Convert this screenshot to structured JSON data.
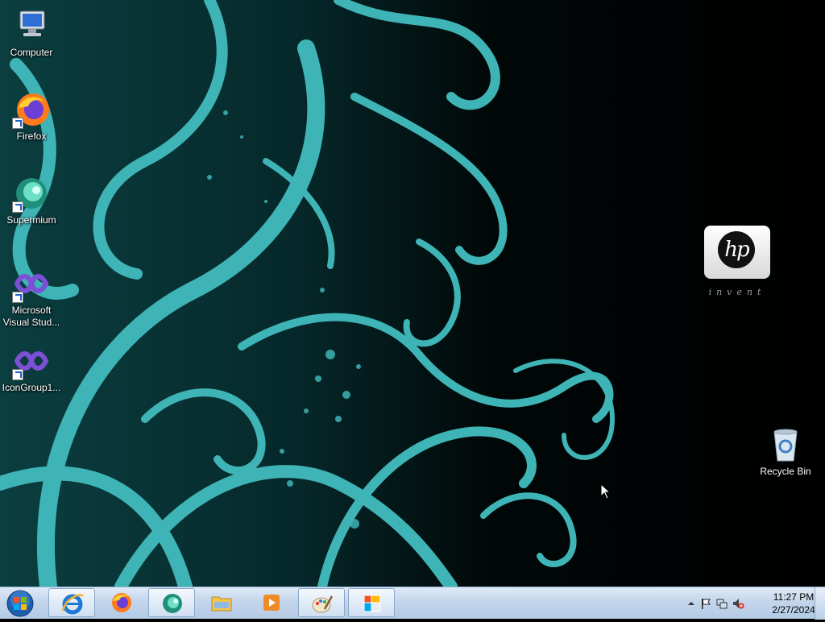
{
  "desktop": {
    "icons": [
      {
        "label": "Computer",
        "icon": "computer-icon"
      },
      {
        "label": "Firefox",
        "icon": "firefox-icon"
      },
      {
        "label": "Supermium",
        "icon": "supermium-icon"
      },
      {
        "label_line1": "Microsoft",
        "label_line2": "Visual Stud...",
        "icon": "visual-studio-icon"
      },
      {
        "label": "IconGroup1...",
        "icon": "visual-studio-icon"
      },
      {
        "label": "Recycle Bin",
        "icon": "recycle-bin-icon"
      }
    ],
    "wallpaper_logo": {
      "mark": "hp",
      "tagline": "invent"
    }
  },
  "taskbar": {
    "start": {
      "icon": "windows-start-orb-icon"
    },
    "pinned": [
      {
        "name": "internet-explorer",
        "icon": "internet-explorer-icon",
        "active": true
      },
      {
        "name": "firefox",
        "icon": "firefox-icon",
        "active": false
      },
      {
        "name": "supermium",
        "icon": "supermium-icon",
        "active": true
      },
      {
        "name": "file-explorer",
        "icon": "folder-icon",
        "active": false
      },
      {
        "name": "media-player",
        "icon": "media-player-icon",
        "active": false
      },
      {
        "name": "paint",
        "icon": "paint-icon",
        "active": true
      },
      {
        "name": "control-panel",
        "icon": "control-panel-icon",
        "active": true
      }
    ],
    "tray": {
      "icons": [
        "show-hidden-icons-arrow",
        "action-center-flag-icon",
        "network-icon",
        "volume-muted-icon"
      ],
      "time": "11:27 PM",
      "date": "2/27/2024"
    }
  },
  "colors": {
    "teal": "#3fb4b6",
    "taskbar": "#c4d6ec",
    "background": "#000000"
  }
}
